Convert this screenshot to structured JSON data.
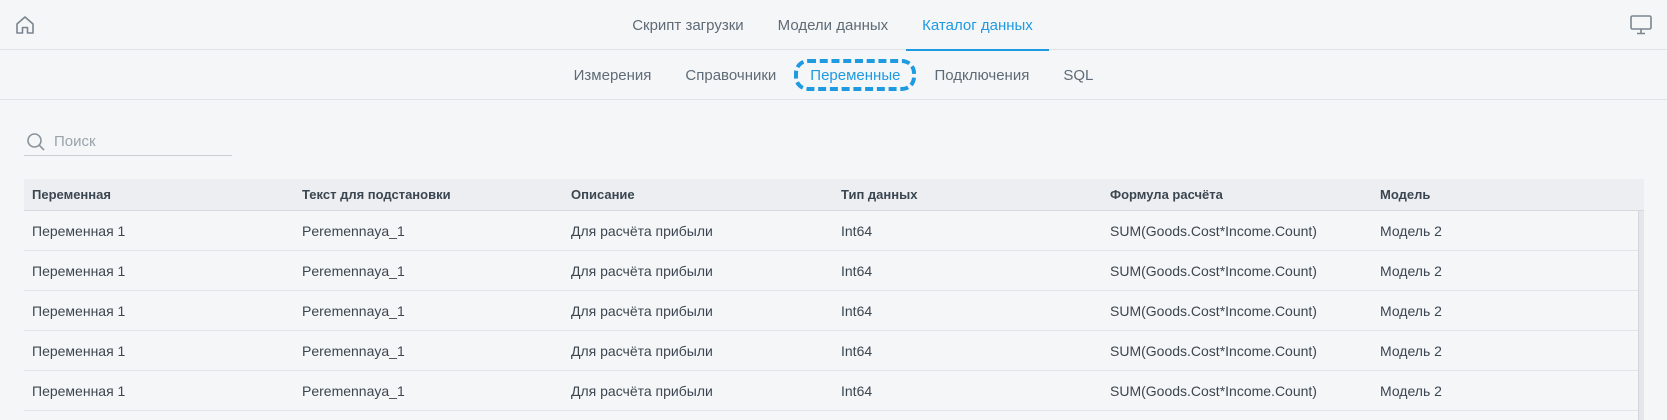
{
  "top_tabs": [
    {
      "label": "Скрипт загрузки",
      "active": false
    },
    {
      "label": "Модели данных",
      "active": false
    },
    {
      "label": "Каталог данных",
      "active": true
    }
  ],
  "sub_tabs": [
    {
      "label": "Измерения",
      "active": false
    },
    {
      "label": "Справочники",
      "active": false
    },
    {
      "label": "Переменные",
      "active": true
    },
    {
      "label": "Подключения",
      "active": false
    },
    {
      "label": "SQL",
      "active": false
    }
  ],
  "search": {
    "placeholder": "Поиск",
    "value": ""
  },
  "table": {
    "headers": [
      "Переменная",
      "Текст для подстановки",
      "Описание",
      "Тип данных",
      "Формула расчёта",
      "Модель"
    ],
    "rows": [
      [
        "Переменная 1",
        "Peremennaya_1",
        "Для расчёта прибыли",
        "Int64",
        "SUM(Goods.Cost*Income.Count)",
        "Модель 2"
      ],
      [
        "Переменная 1",
        "Peremennaya_1",
        "Для расчёта прибыли",
        "Int64",
        "SUM(Goods.Cost*Income.Count)",
        "Модель 2"
      ],
      [
        "Переменная 1",
        "Peremennaya_1",
        "Для расчёта прибыли",
        "Int64",
        "SUM(Goods.Cost*Income.Count)",
        "Модель 2"
      ],
      [
        "Переменная 1",
        "Peremennaya_1",
        "Для расчёта прибыли",
        "Int64",
        "SUM(Goods.Cost*Income.Count)",
        "Модель 2"
      ],
      [
        "Переменная 1",
        "Peremennaya_1",
        "Для расчёта прибыли",
        "Int64",
        "SUM(Goods.Cost*Income.Count)",
        "Модель 2"
      ]
    ]
  },
  "icons": {
    "home": "home-icon",
    "monitor": "monitor-icon",
    "search": "search-icon"
  },
  "colors": {
    "accent": "#1e9ae0",
    "background": "#f5f6f8",
    "header_bg": "#eceef1"
  }
}
